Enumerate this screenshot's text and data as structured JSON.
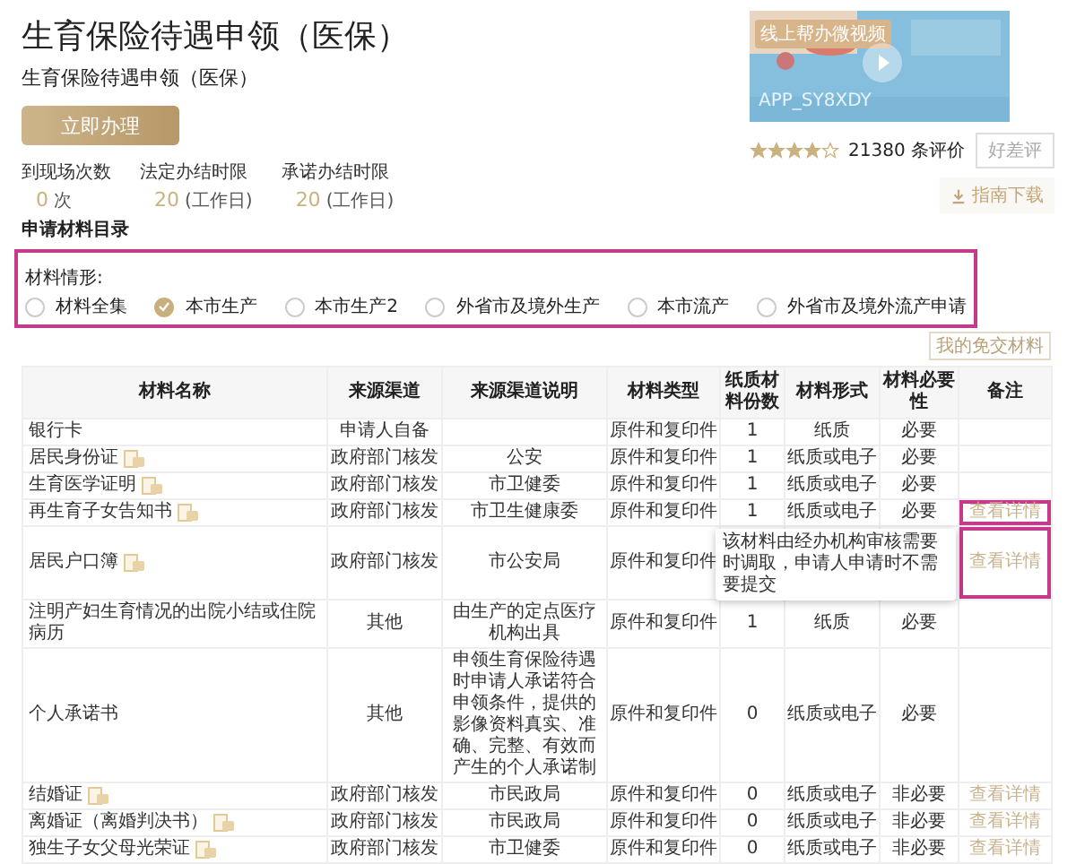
{
  "title": "生育保险待遇申领（医保）",
  "subtitle": "生育保险待遇申领（医保）",
  "apply_button": "立即办理",
  "stats": [
    {
      "label": "到现场次数",
      "value": "0",
      "unit": "次"
    },
    {
      "label": "法定办结时限",
      "value": "20",
      "unit": "(工作日)"
    },
    {
      "label": "承诺办结时限",
      "value": "20",
      "unit": "(工作日)"
    }
  ],
  "video": {
    "kind": "picture",
    "badge": "线上帮办微视频",
    "code": "APP_SY8XDY"
  },
  "rating": {
    "stars": 4,
    "count": "21380 条评价",
    "review_button": "好差评"
  },
  "download_button": "指南下载",
  "section_title": "申请材料目录",
  "situations": {
    "label": "材料情形:",
    "highlighted": true,
    "options": [
      {
        "label": "材料全集",
        "selected": false
      },
      {
        "label": "本市生产",
        "selected": true
      },
      {
        "label": "本市生产2",
        "selected": false
      },
      {
        "label": "外省市及境外生产",
        "selected": false
      },
      {
        "label": "本市流产",
        "selected": false
      },
      {
        "label": "外省市及境外流产申请",
        "selected": false
      }
    ]
  },
  "exempt_button": "我的免交材料",
  "table": {
    "columns": [
      "材料名称",
      "来源渠道",
      "来源渠道说明",
      "材料类型",
      "纸质材料份数",
      "材料形式",
      "材料必要性",
      "备注"
    ],
    "rows": [
      {
        "name": "银行卡",
        "doc_icon": false,
        "channel": "申请人自备",
        "type": "原件和复印件",
        "copies": "1",
        "form": "纸质",
        "necessity": "必要"
      },
      {
        "name": "居民身份证",
        "doc_icon": true,
        "channel": "政府部门核发",
        "note": "公安",
        "type": "原件和复印件",
        "copies": "1",
        "form": "纸质或电子",
        "necessity": "必要"
      },
      {
        "name": "生育医学证明",
        "doc_icon": true,
        "channel": "政府部门核发",
        "note": "市卫健委",
        "type": "原件和复印件",
        "copies": "1",
        "form": "纸质或电子",
        "necessity": "必要"
      },
      {
        "name": "再生育子女告知书",
        "doc_icon": true,
        "channel": "政府部门核发",
        "note": "市卫生健康委",
        "type": "原件和复印件",
        "copies": "1",
        "form": "纸质或电子",
        "necessity": "必要",
        "remark": "查看详情",
        "highlighted": true
      },
      {
        "name": "居民户口簿",
        "doc_icon": true,
        "channel": "政府部门核发",
        "note": "市公安局",
        "type": "原件和复印件",
        "remark": "查看详情",
        "highlighted": true,
        "tooltip": "该材料由经办机构审核需要时调取，申请人申请时不需要提交"
      },
      {
        "name": "注明产妇生育情况的出院小结或住院病历",
        "doc_icon": false,
        "channel": "其他",
        "note": "由生产的定点医疗机构出具",
        "type": "原件和复印件",
        "copies": "1",
        "form": "纸质",
        "necessity": "必要"
      },
      {
        "name": "个人承诺书",
        "doc_icon": false,
        "channel": "其他",
        "note": "申领生育保险待遇时申请人承诺符合申领条件，提供的影像资料真实、准确、完整、有效而产生的个人承诺制",
        "type": "原件和复印件",
        "copies": "0",
        "form": "纸质或电子",
        "necessity": "必要"
      },
      {
        "name": "结婚证",
        "doc_icon": true,
        "channel": "政府部门核发",
        "note": "市民政局",
        "type": "原件和复印件",
        "copies": "0",
        "form": "纸质或电子",
        "necessity": "非必要",
        "remark": "查看详情"
      },
      {
        "name": "离婚证（离婚判决书）",
        "doc_icon": true,
        "channel": "政府部门核发",
        "note": "市民政局",
        "type": "原件和复印件",
        "copies": "0",
        "form": "纸质或电子",
        "necessity": "非必要",
        "remark": "查看详情"
      },
      {
        "name": "独生子女父母光荣证",
        "doc_icon": true,
        "channel": "政府部门核发",
        "note": "市卫健委",
        "type": "原件和复印件",
        "copies": "0",
        "form": "纸质或电子",
        "necessity": "非必要",
        "remark": "查看详情"
      }
    ]
  }
}
